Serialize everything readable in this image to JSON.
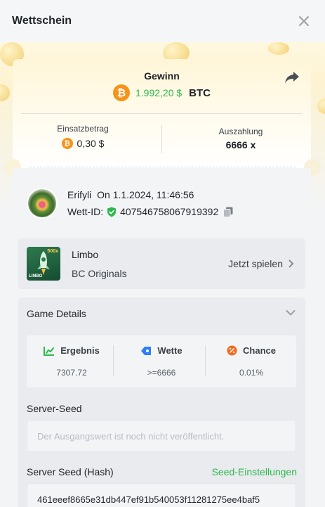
{
  "header": {
    "title": "Wettschein",
    "close_icon": "close-icon"
  },
  "ticket": {
    "gain_label": "Gewinn",
    "gain_value": "1.992,20 $",
    "gain_currency": "BTC",
    "btc_symbol": "₿",
    "stake_label": "Einsatzbetrag",
    "stake_value": "0,30 $",
    "payout_label": "Auszahlung",
    "payout_value": "6666 x",
    "share_icon": "share-icon"
  },
  "user": {
    "name": "Erifyli",
    "on_text": "On 1.1.2024, 11:46:56",
    "bet_id_label": "Wett-ID:",
    "bet_id": "407546758067919392"
  },
  "game": {
    "name": "Limbo",
    "provider": "BC Originals",
    "play_label": "Jetzt spielen",
    "thumb_text": "LIMBO",
    "thumb_multiplier": "500x"
  },
  "details": {
    "title": "Game Details",
    "stats": [
      {
        "label": "Ergebnis",
        "value": "7307.72",
        "icon": "result-icon"
      },
      {
        "label": "Wette",
        "value": ">=6666",
        "icon": "bet-tag-icon"
      },
      {
        "label": "Chance",
        "value": "0.01%",
        "icon": "percent-icon"
      }
    ],
    "server_seed_label": "Server-Seed",
    "server_seed_placeholder": "Der Ausgangswert ist noch nicht veröffentlicht.",
    "server_seed_hash_label": "Server Seed (Hash)",
    "seed_settings_label": "Seed-Einstellungen",
    "server_seed_hash": "461eeef8665e31db447ef91b540053f11281275ee4baf5"
  },
  "colors": {
    "accent_green": "#2db84d",
    "btc_orange": "#f7931a",
    "background": "#f3f4f6"
  }
}
